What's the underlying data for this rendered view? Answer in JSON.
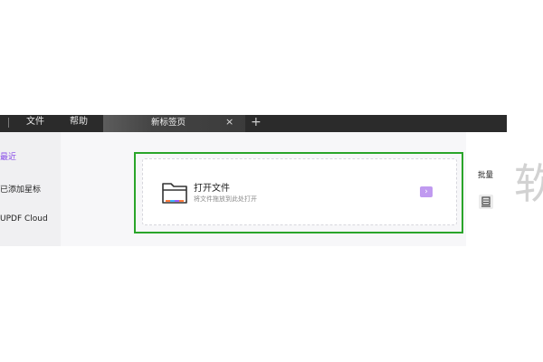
{
  "menubar": {
    "file": "文件",
    "help": "帮助"
  },
  "tab": {
    "title": "新标签页",
    "close_glyph": "×",
    "new_tab_glyph": "+"
  },
  "sidebar": {
    "items": [
      {
        "label": "最近",
        "active": true
      },
      {
        "label": "已添加星标"
      },
      {
        "label": "UPDF Cloud"
      }
    ]
  },
  "open_file": {
    "title": "打开文件",
    "subtitle": "将文件拖放到此处打开",
    "arrow_glyph": "›"
  },
  "right_panel": {
    "batch_label": "批量",
    "partial_glyph": "软"
  },
  "colors": {
    "accent": "#8a4fe8",
    "highlight_border": "#2aa52a",
    "arrow_button": "#c09af0"
  },
  "icons": [
    "folder-icon",
    "close-icon",
    "plus-icon",
    "chevron-right-icon",
    "batch-icon"
  ]
}
